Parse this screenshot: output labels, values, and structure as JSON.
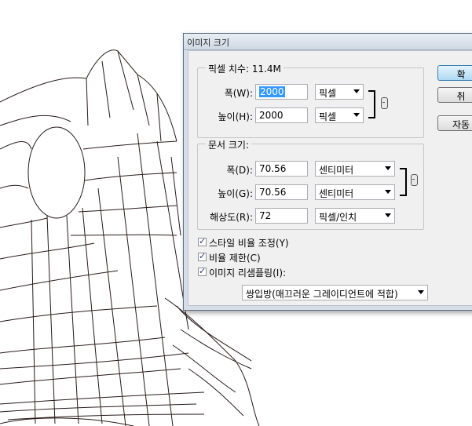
{
  "dialog": {
    "title": "이미지 크기",
    "pixel_dimensions": {
      "legend": "픽셀 치수: 11.4M",
      "width_label": "폭(W):",
      "width_value": "2000",
      "width_unit": "픽셀",
      "height_label": "높이(H):",
      "height_value": "2000",
      "height_unit": "픽셀"
    },
    "document_size": {
      "legend": "문서 크기:",
      "width_label": "폭(D):",
      "width_value": "70.56",
      "width_unit": "센티미터",
      "height_label": "높이(G):",
      "height_value": "70.56",
      "height_unit": "센티미터",
      "resolution_label": "해상도(R):",
      "resolution_value": "72",
      "resolution_unit": "픽셀/인치"
    },
    "options": {
      "scale_styles": "스타일 비율 조정(Y)",
      "constrain": "비율 제한(C)",
      "resample": "이미지 리샘플링(I):",
      "resample_method": "쌍입방(매끄러운 그레이디언트에 적합)"
    },
    "buttons": {
      "ok": "확",
      "cancel": "취",
      "auto": "자동"
    }
  }
}
